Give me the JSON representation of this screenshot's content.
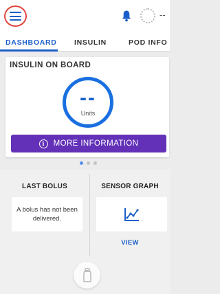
{
  "header": {
    "menu_icon": "hamburger-menu-icon",
    "notification_icon": "bell-icon",
    "pod_status_icon": "pod-status-icon",
    "pod_status_text": "--"
  },
  "tabs": [
    {
      "label": "DASHBOARD",
      "active": true
    },
    {
      "label": "INSULIN",
      "active": false
    },
    {
      "label": "POD INFO",
      "active": false
    }
  ],
  "iob": {
    "title": "INSULIN ON BOARD",
    "value": "--",
    "unit": "Units",
    "more_button": "MORE INFORMATION",
    "info_icon_glyph": "i"
  },
  "pager": {
    "total": 3,
    "active_index": 0
  },
  "last_bolus": {
    "title": "LAST BOLUS",
    "message": "A bolus has not been delivered."
  },
  "sensor_graph": {
    "title": "SENSOR GRAPH",
    "icon": "graph-icon",
    "view_label": "VIEW"
  },
  "bolus_button": {
    "icon": "bolus-vial-icon"
  },
  "colors": {
    "accent_blue": "#1a5fc8",
    "ring_blue": "#1a6fe0",
    "purple": "#6231b8",
    "highlight_red": "#e0463e"
  }
}
